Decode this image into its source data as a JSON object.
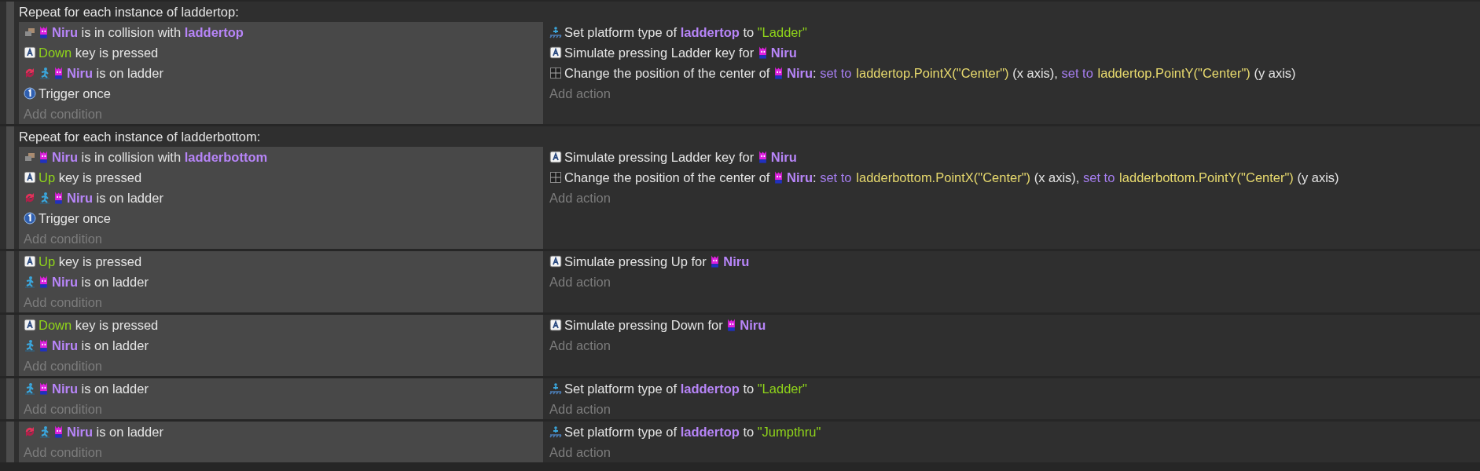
{
  "events": [
    {
      "header": "Repeat for each instance of laddertop:",
      "add_condition": "Add condition",
      "add_action": "Add action",
      "conditions": [
        {
          "inverted": false,
          "kind": "collision",
          "parts": [
            {
              "kind": "object",
              "text": "Niru",
              "sprite": true
            },
            {
              "kind": "text",
              "text": " is in collision with "
            },
            {
              "kind": "object",
              "text": "laddertop",
              "sprite": false
            }
          ]
        },
        {
          "inverted": false,
          "kind": "keyboard",
          "parts": [
            {
              "kind": "param",
              "text": "Down"
            },
            {
              "kind": "text",
              "text": " key is pressed"
            }
          ]
        },
        {
          "inverted": true,
          "kind": "platformer",
          "parts": [
            {
              "kind": "object",
              "text": "Niru",
              "sprite": true
            },
            {
              "kind": "text",
              "text": " is on ladder"
            }
          ]
        },
        {
          "inverted": false,
          "kind": "trigger",
          "parts": [
            {
              "kind": "text",
              "text": "Trigger once"
            }
          ]
        }
      ],
      "actions": [
        {
          "kind": "platform",
          "parts": [
            {
              "kind": "text",
              "text": "Set platform type of "
            },
            {
              "kind": "object",
              "text": "laddertop",
              "sprite": false
            },
            {
              "kind": "text",
              "text": " to "
            },
            {
              "kind": "param",
              "text": "\"Ladder\""
            }
          ]
        },
        {
          "kind": "keyboard",
          "parts": [
            {
              "kind": "text",
              "text": "Simulate pressing Ladder key for "
            },
            {
              "kind": "object",
              "text": "Niru",
              "sprite": true
            }
          ]
        },
        {
          "kind": "position",
          "parts": [
            {
              "kind": "text",
              "text": "Change the position of the center of "
            },
            {
              "kind": "object",
              "text": "Niru",
              "sprite": true
            },
            {
              "kind": "text",
              "text": ": "
            },
            {
              "kind": "keyword",
              "text": "set to"
            },
            {
              "kind": "expr",
              "text": "laddertop.PointX(\"Center\")"
            },
            {
              "kind": "text",
              "text": " (x axis), "
            },
            {
              "kind": "keyword",
              "text": "set to"
            },
            {
              "kind": "expr",
              "text": "laddertop.PointY(\"Center\")"
            },
            {
              "kind": "text",
              "text": " (y axis)"
            }
          ]
        }
      ]
    },
    {
      "header": "Repeat for each instance of ladderbottom:",
      "add_condition": "Add condition",
      "add_action": "Add action",
      "conditions": [
        {
          "inverted": false,
          "kind": "collision",
          "parts": [
            {
              "kind": "object",
              "text": "Niru",
              "sprite": true
            },
            {
              "kind": "text",
              "text": " is in collision with "
            },
            {
              "kind": "object",
              "text": "ladderbottom",
              "sprite": false
            }
          ]
        },
        {
          "inverted": false,
          "kind": "keyboard",
          "parts": [
            {
              "kind": "param",
              "text": "Up"
            },
            {
              "kind": "text",
              "text": " key is pressed"
            }
          ]
        },
        {
          "inverted": true,
          "kind": "platformer",
          "parts": [
            {
              "kind": "object",
              "text": "Niru",
              "sprite": true
            },
            {
              "kind": "text",
              "text": " is on ladder"
            }
          ]
        },
        {
          "inverted": false,
          "kind": "trigger",
          "parts": [
            {
              "kind": "text",
              "text": "Trigger once"
            }
          ]
        }
      ],
      "actions": [
        {
          "kind": "keyboard",
          "parts": [
            {
              "kind": "text",
              "text": "Simulate pressing Ladder key for "
            },
            {
              "kind": "object",
              "text": "Niru",
              "sprite": true
            }
          ]
        },
        {
          "kind": "position",
          "parts": [
            {
              "kind": "text",
              "text": "Change the position of the center of "
            },
            {
              "kind": "object",
              "text": "Niru",
              "sprite": true
            },
            {
              "kind": "text",
              "text": ": "
            },
            {
              "kind": "keyword",
              "text": "set to"
            },
            {
              "kind": "expr",
              "text": "ladderbottom.PointX(\"Center\")"
            },
            {
              "kind": "text",
              "text": " (x axis), "
            },
            {
              "kind": "keyword",
              "text": "set to"
            },
            {
              "kind": "expr",
              "text": "ladderbottom.PointY(\"Center\")"
            },
            {
              "kind": "text",
              "text": " (y axis)"
            }
          ]
        }
      ]
    },
    {
      "add_condition": "Add condition",
      "add_action": "Add action",
      "conditions": [
        {
          "inverted": false,
          "kind": "keyboard",
          "parts": [
            {
              "kind": "param",
              "text": "Up"
            },
            {
              "kind": "text",
              "text": " key is pressed"
            }
          ]
        },
        {
          "inverted": false,
          "kind": "platformer",
          "parts": [
            {
              "kind": "object",
              "text": "Niru",
              "sprite": true
            },
            {
              "kind": "text",
              "text": " is on ladder"
            }
          ]
        }
      ],
      "actions": [
        {
          "kind": "keyboard",
          "parts": [
            {
              "kind": "text",
              "text": "Simulate pressing Up for "
            },
            {
              "kind": "object",
              "text": "Niru",
              "sprite": true
            }
          ]
        }
      ]
    },
    {
      "add_condition": "Add condition",
      "add_action": "Add action",
      "conditions": [
        {
          "inverted": false,
          "kind": "keyboard",
          "parts": [
            {
              "kind": "param",
              "text": "Down"
            },
            {
              "kind": "text",
              "text": " key is pressed"
            }
          ]
        },
        {
          "inverted": false,
          "kind": "platformer",
          "parts": [
            {
              "kind": "object",
              "text": "Niru",
              "sprite": true
            },
            {
              "kind": "text",
              "text": " is on ladder"
            }
          ]
        }
      ],
      "actions": [
        {
          "kind": "keyboard",
          "parts": [
            {
              "kind": "text",
              "text": "Simulate pressing Down for "
            },
            {
              "kind": "object",
              "text": "Niru",
              "sprite": true
            }
          ]
        }
      ]
    },
    {
      "add_condition": "Add condition",
      "add_action": "Add action",
      "conditions": [
        {
          "inverted": false,
          "kind": "platformer",
          "parts": [
            {
              "kind": "object",
              "text": "Niru",
              "sprite": true
            },
            {
              "kind": "text",
              "text": " is on ladder"
            }
          ]
        }
      ],
      "actions": [
        {
          "kind": "platform",
          "parts": [
            {
              "kind": "text",
              "text": "Set platform type of "
            },
            {
              "kind": "object",
              "text": "laddertop",
              "sprite": false
            },
            {
              "kind": "text",
              "text": " to "
            },
            {
              "kind": "param",
              "text": "\"Ladder\""
            }
          ]
        }
      ]
    },
    {
      "add_condition": "Add condition",
      "add_action": "Add action",
      "conditions": [
        {
          "inverted": true,
          "kind": "platformer",
          "parts": [
            {
              "kind": "object",
              "text": "Niru",
              "sprite": true
            },
            {
              "kind": "text",
              "text": " is on ladder"
            }
          ]
        }
      ],
      "actions": [
        {
          "kind": "platform",
          "parts": [
            {
              "kind": "text",
              "text": "Set platform type of "
            },
            {
              "kind": "object",
              "text": "laddertop",
              "sprite": false
            },
            {
              "kind": "text",
              "text": " to "
            },
            {
              "kind": "param",
              "text": "\"Jumpthru\""
            }
          ]
        }
      ]
    }
  ]
}
